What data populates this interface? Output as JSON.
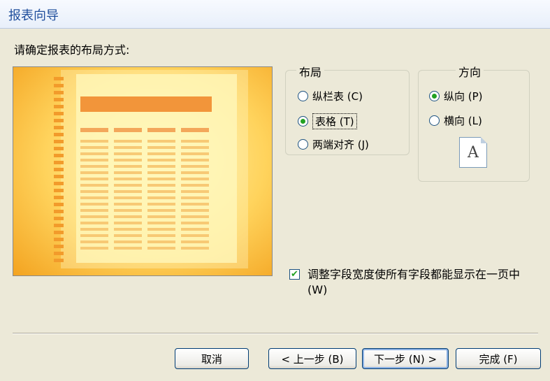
{
  "window": {
    "title": "报表向导"
  },
  "prompt": "请确定报表的布局方式:",
  "layout_group": {
    "label": "布局",
    "options": [
      {
        "label": "纵栏表 (C)",
        "selected": false
      },
      {
        "label": "表格 (T)",
        "selected": true
      },
      {
        "label": "两端对齐 (J)",
        "selected": false
      }
    ]
  },
  "orientation_group": {
    "label": "方向",
    "options": [
      {
        "label": "纵向 (P)",
        "selected": true
      },
      {
        "label": "横向 (L)",
        "selected": false
      }
    ],
    "preview_letter": "A"
  },
  "fit_fields": {
    "label": "调整字段宽度使所有字段都能显示在一页中 (W)",
    "checked": true
  },
  "buttons": {
    "cancel": "取消",
    "back": "< 上一步 (B)",
    "next": "下一步 (N) >",
    "finish": "完成 (F)"
  },
  "colors": {
    "accent": "#21A121",
    "title": "#1F4E9C",
    "preview": "#F3A320"
  }
}
